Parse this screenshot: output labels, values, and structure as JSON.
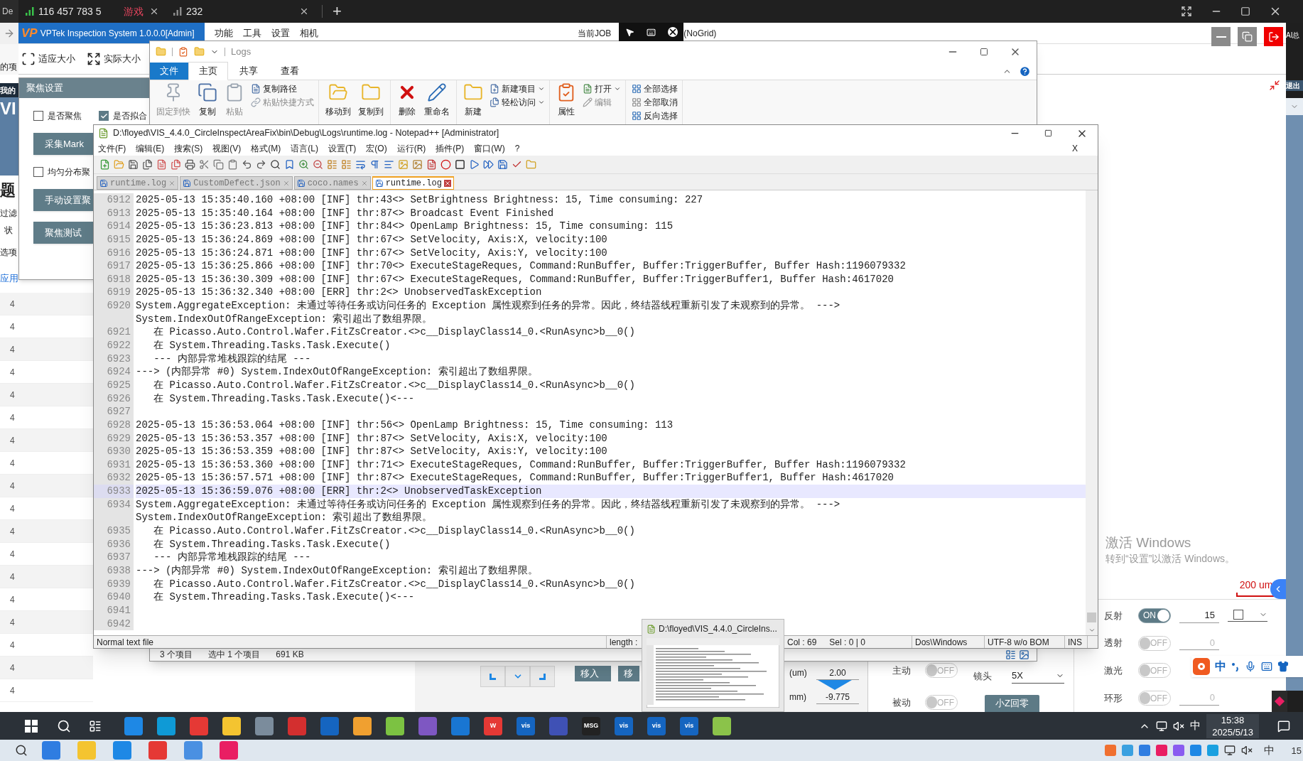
{
  "browser": {
    "partial_tab": "De",
    "tabs": [
      {
        "kind": "signal",
        "label": "116 457 783 5",
        "color": "#39c24a"
      },
      {
        "kind": "text",
        "label": "游戏",
        "color": "#e8455f"
      },
      {
        "kind": "signal",
        "label": "232",
        "color": "#8a8a8a"
      }
    ],
    "new_tab": "+"
  },
  "left_window": {
    "toolbar_text": "的项",
    "banner_small": "我的",
    "banner_large": "VI",
    "heading": "题",
    "filter_label": "过滤",
    "status_label": "状",
    "options_label": "选项",
    "apply_link": "应用",
    "list_values": [
      "4",
      "4",
      "4",
      "4",
      "4",
      "4",
      "4",
      "4",
      "4",
      "4",
      "4",
      "4",
      "4",
      "4",
      "4",
      "4",
      "4",
      "4"
    ]
  },
  "app": {
    "logo": "VP",
    "title": "VPTek Inspection System 1.0.0.0[Admin]",
    "menu": [
      "功能",
      "工具",
      "设置",
      "相机"
    ],
    "job_label": "当前JOB",
    "grid_mode": "(NoGrid)",
    "toolbar": [
      "适应大小",
      "实际大小"
    ],
    "side_texts": [
      "AI总",
      "退出"
    ],
    "scale_label": "200 um"
  },
  "focus_dialog": {
    "title": "聚焦设置",
    "rows": [
      [
        {
          "kind": "checkbox",
          "label": "是否聚焦",
          "checked": false
        },
        {
          "kind": "checkbox",
          "label": "是否拟合",
          "checked": true
        }
      ],
      [
        {
          "kind": "button",
          "label": "采集Mark"
        }
      ],
      [
        {
          "kind": "checkbox",
          "label": "均匀分布聚",
          "checked": false
        }
      ],
      [
        {
          "kind": "button",
          "label": "手动设置聚"
        }
      ],
      [
        {
          "kind": "button",
          "label": "聚焦测试"
        }
      ]
    ]
  },
  "explorer": {
    "title": "Logs",
    "tabs": [
      {
        "label": "文件",
        "kind": "file",
        "selected": false
      },
      {
        "label": "主页",
        "kind": "tab",
        "selected": true
      },
      {
        "label": "共享",
        "kind": "tab",
        "selected": false
      },
      {
        "label": "查看",
        "kind": "tab",
        "selected": false
      }
    ],
    "ribbon": [
      {
        "large": [
          {
            "label": "固定到快",
            "disabled": true
          },
          {
            "label": "复制",
            "disabled": false
          },
          {
            "label": "粘贴",
            "disabled": true
          }
        ],
        "small": [
          {
            "label": "复制路径",
            "disabled": false,
            "dropdown": false
          },
          {
            "label": "粘贴快捷方式",
            "disabled": true,
            "dropdown": false
          }
        ]
      },
      {
        "large": [
          {
            "label": "移动到",
            "disabled": false
          },
          {
            "label": "复制到",
            "disabled": false
          }
        ]
      },
      {
        "large": [
          {
            "label": "删除",
            "disabled": false
          },
          {
            "label": "重命名",
            "disabled": false
          }
        ]
      },
      {
        "large": [
          {
            "label": "新建",
            "disabled": false
          }
        ],
        "small": [
          {
            "label": "新建项目",
            "disabled": false,
            "dropdown": true
          },
          {
            "label": "轻松访问",
            "disabled": false,
            "dropdown": true
          }
        ]
      },
      {
        "large": [
          {
            "label": "属性",
            "disabled": false
          }
        ],
        "small": [
          {
            "label": "打开",
            "disabled": false,
            "dropdown": true
          },
          {
            "label": "编辑",
            "disabled": true,
            "dropdown": false
          }
        ]
      },
      {
        "small": [
          {
            "label": "全部选择",
            "disabled": false,
            "dropdown": false
          },
          {
            "label": "全部取消",
            "disabled": false,
            "dropdown": false
          },
          {
            "label": "反向选择",
            "disabled": false,
            "dropdown": false
          }
        ]
      }
    ],
    "status": [
      "3 个项目",
      "选中 1 个项目",
      "691 KB"
    ]
  },
  "notepad": {
    "title": "D:\\floyed\\VIS_4.4.0_CircleInspectAreaFix\\bin\\Debug\\Logs\\runtime.log - Notepad++ [Administrator]",
    "menu": [
      "文件(F)",
      "编辑(E)",
      "搜索(S)",
      "视图(V)",
      "格式(M)",
      "语言(L)",
      "设置(T)",
      "宏(O)",
      "运行(R)",
      "插件(P)",
      "窗口(W)",
      "?"
    ],
    "close_doc": "X",
    "tabs": [
      {
        "label": "runtime.log",
        "selected": false
      },
      {
        "label": "CustomDefect.json",
        "selected": false
      },
      {
        "label": "coco.names",
        "selected": false
      },
      {
        "label": "runtime.log",
        "selected": true
      }
    ],
    "lines": [
      {
        "number": "6912",
        "rows": [
          "2025-05-13 15:35:40.160 +08:00 [INF] thr:43<> SetBrightness Brightness: 15, Time consuming: 227"
        ],
        "selected": false
      },
      {
        "number": "6913",
        "rows": [
          "2025-05-13 15:35:40.164 +08:00 [INF] thr:87<> Broadcast Event Finished"
        ],
        "selected": false
      },
      {
        "number": "6914",
        "rows": [
          "2025-05-13 15:36:23.813 +08:00 [INF] thr:84<> OpenLamp Brightness: 15, Time consuming: 115"
        ],
        "selected": false
      },
      {
        "number": "6915",
        "rows": [
          "2025-05-13 15:36:24.869 +08:00 [INF] thr:67<> SetVelocity, Axis:X, velocity:100"
        ],
        "selected": false
      },
      {
        "number": "6916",
        "rows": [
          "2025-05-13 15:36:24.871 +08:00 [INF] thr:67<> SetVelocity, Axis:Y, velocity:100"
        ],
        "selected": false
      },
      {
        "number": "6917",
        "rows": [
          "2025-05-13 15:36:25.866 +08:00 [INF] thr:70<> ExecuteStageReques, Command:RunBuffer, Buffer:TriggerBuffer, Buffer Hash:1196079332"
        ],
        "selected": false
      },
      {
        "number": "6918",
        "rows": [
          "2025-05-13 15:36:30.309 +08:00 [INF] thr:67<> ExecuteStageReques, Command:RunBuffer, Buffer:TriggerBuffer1, Buffer Hash:4617020"
        ],
        "selected": false
      },
      {
        "number": "6919",
        "rows": [
          "2025-05-13 15:36:32.340 +08:00 [ERR] thr:2<> UnobservedTaskException"
        ],
        "selected": false
      },
      {
        "number": "6920",
        "rows": [
          "System.AggregateException: 未通过等待任务或访问任务的 Exception 属性观察到任务的异常。因此，终结器线程重新引发了未观察到的异常。 --->",
          "System.IndexOutOfRangeException: 索引超出了数组界限。"
        ],
        "selected": false
      },
      {
        "number": "6921",
        "rows": [
          "   在 Picasso.Auto.Control.Wafer.FitZsCreator.<>c__DisplayClass14_0.<RunAsync>b__0()"
        ],
        "selected": false
      },
      {
        "number": "6922",
        "rows": [
          "   在 System.Threading.Tasks.Task.Execute()"
        ],
        "selected": false
      },
      {
        "number": "6923",
        "rows": [
          "   --- 内部异常堆栈跟踪的结尾 ---"
        ],
        "selected": false
      },
      {
        "number": "6924",
        "rows": [
          "---> (内部异常 #0) System.IndexOutOfRangeException: 索引超出了数组界限。"
        ],
        "selected": false
      },
      {
        "number": "6925",
        "rows": [
          "   在 Picasso.Auto.Control.Wafer.FitZsCreator.<>c__DisplayClass14_0.<RunAsync>b__0()"
        ],
        "selected": false
      },
      {
        "number": "6926",
        "rows": [
          "   在 System.Threading.Tasks.Task.Execute()<---"
        ],
        "selected": false
      },
      {
        "number": "6927",
        "selected": false
      },
      {
        "number": "6928",
        "rows": [
          "2025-05-13 15:36:53.064 +08:00 [INF] thr:56<> OpenLamp Brightness: 15, Time consuming: 113"
        ],
        "selected": false
      },
      {
        "number": "6929",
        "rows": [
          "2025-05-13 15:36:53.357 +08:00 [INF] thr:87<> SetVelocity, Axis:X, velocity:100"
        ],
        "selected": false
      },
      {
        "number": "6930",
        "rows": [
          "2025-05-13 15:36:53.359 +08:00 [INF] thr:87<> SetVelocity, Axis:Y, velocity:100"
        ],
        "selected": false
      },
      {
        "number": "6931",
        "rows": [
          "2025-05-13 15:36:53.360 +08:00 [INF] thr:71<> ExecuteStageReques, Command:RunBuffer, Buffer:TriggerBuffer, Buffer Hash:1196079332"
        ],
        "selected": false
      },
      {
        "number": "6932",
        "rows": [
          "2025-05-13 15:36:57.571 +08:00 [INF] thr:87<> ExecuteStageReques, Command:RunBuffer, Buffer:TriggerBuffer1, Buffer Hash:4617020"
        ],
        "selected": false
      },
      {
        "number": "6933",
        "rows": [
          "2025-05-13 15:36:59.076 +08:00 [ERR] thr:2<> UnobservedTaskException"
        ],
        "selected": true
      },
      {
        "number": "6934",
        "rows": [
          "System.AggregateException: 未通过等待任务或访问任务的 Exception 属性观察到任务的异常。因此，终结器线程重新引发了未观察到的异常。 --->",
          "System.IndexOutOfRangeException: 索引超出了数组界限。"
        ],
        "selected": false
      },
      {
        "number": "6935",
        "rows": [
          "   在 Picasso.Auto.Control.Wafer.FitZsCreator.<>c__DisplayClass14_0.<RunAsync>b__0()"
        ],
        "selected": false
      },
      {
        "number": "6936",
        "rows": [
          "   在 System.Threading.Tasks.Task.Execute()"
        ],
        "selected": false
      },
      {
        "number": "6937",
        "rows": [
          "   --- 内部异常堆栈跟踪的结尾 ---"
        ],
        "selected": false
      },
      {
        "number": "6938",
        "rows": [
          "---> (内部异常 #0) System.IndexOutOfRangeException: 索引超出了数组界限。"
        ],
        "selected": false
      },
      {
        "number": "6939",
        "rows": [
          "   在 Picasso.Auto.Control.Wafer.FitZsCreator.<>c__DisplayClass14_0.<RunAsync>b__0()"
        ],
        "selected": false
      },
      {
        "number": "6940",
        "rows": [
          "   在 System.Threading.Tasks.Task.Execute()<---"
        ],
        "selected": false
      },
      {
        "number": "6941",
        "selected": false
      },
      {
        "number": "6942",
        "selected": false
      }
    ],
    "status": [
      [
        "Normal text file"
      ],
      [
        "length :"
      ],
      [
        "Col : 69",
        "Sel : 0 | 0"
      ],
      [
        "Dos\\Windows"
      ],
      [
        "UTF-8 w/o BOM"
      ],
      [
        "INS"
      ]
    ]
  },
  "thumbnail": {
    "title": "D:\\floyed\\VIS_4.4.0_CircleIns..."
  },
  "stage": {
    "move_buttons": [
      "移入",
      "移"
    ],
    "fields": [
      {
        "unit": "(um)",
        "value": "2.00"
      },
      {
        "unit": "mm)",
        "value": "-9.775"
      }
    ],
    "switches": [
      {
        "label": "主动",
        "on": false,
        "toggle_text": "OFF"
      },
      {
        "label": "被动",
        "on": false,
        "toggle_text": "OFF"
      }
    ],
    "lens": {
      "label": "镜头",
      "value": "5X"
    },
    "home_button": "小Z回零"
  },
  "lights": [
    {
      "label": "反射",
      "on": true,
      "toggle_text": "ON",
      "value": "15",
      "checked": false
    },
    {
      "label": "透射",
      "on": false,
      "toggle_text": "OFF",
      "value": "0"
    },
    {
      "label": "激光",
      "on": false,
      "toggle_text": "OFF"
    },
    {
      "label": "环形",
      "on": false,
      "toggle_text": "OFF",
      "value": "0"
    }
  ],
  "activation": {
    "title": "激活 Windows",
    "subtitle": "转到“设置”以激活 Windows。"
  },
  "ime": {
    "mode": "中"
  },
  "taskbar": {
    "apps": [
      {
        "color": "#1e88e5"
      },
      {
        "color": "#0f9ad6"
      },
      {
        "color": "#e53935"
      },
      {
        "color": "#f4c430"
      },
      {
        "color": "#7b8c9c"
      },
      {
        "color": "#d32f2f"
      },
      {
        "color": "#1565c0"
      },
      {
        "color": "#f0a030"
      },
      {
        "color": "#7cc242"
      },
      {
        "color": "#7e57c2"
      },
      {
        "color": "#1976d2"
      },
      {
        "color": "#e53935",
        "label": "W"
      },
      {
        "color": "#1565c0",
        "label": "vis"
      },
      {
        "color": "#3f51b5"
      },
      {
        "color": "#222222",
        "label": "MSG"
      },
      {
        "color": "#1565c0",
        "label": "vis"
      },
      {
        "color": "#1565c0",
        "label": "vis"
      },
      {
        "color": "#1565c0",
        "label": "vis"
      },
      {
        "color": "#8bc34a"
      }
    ],
    "tray_lang": "中",
    "time": "15:38",
    "date": "2025/5/13"
  },
  "second_taskbar": {
    "apps": [
      {
        "color": "#2f7de1"
      },
      {
        "color": "#f4c430"
      },
      {
        "color": "#1e88e5"
      },
      {
        "color": "#e53935"
      },
      {
        "color": "#4a90e2"
      },
      {
        "color": "#e91e63"
      }
    ],
    "tray_lang": "中",
    "time": "15"
  }
}
